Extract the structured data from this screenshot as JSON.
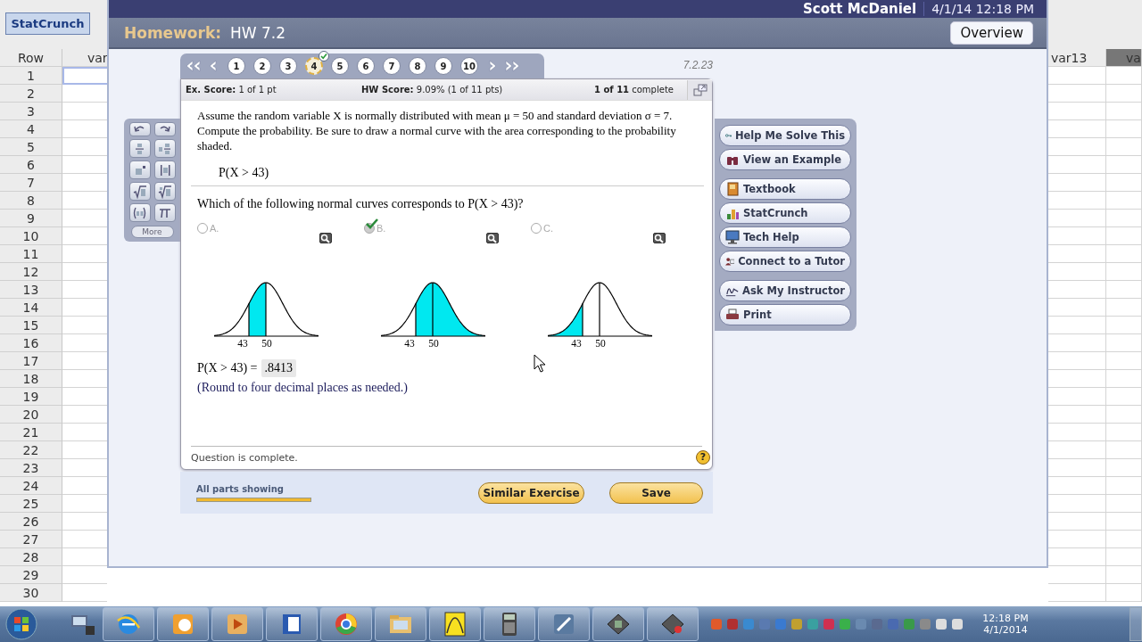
{
  "sheet": {
    "toolbar_button": "StatCrunch",
    "corner": "Row",
    "columns_left": [
      "var"
    ],
    "columns_right": [
      "var13",
      "va"
    ],
    "rows": [
      "1",
      "2",
      "3",
      "4",
      "5",
      "6",
      "7",
      "8",
      "9",
      "10",
      "11",
      "12",
      "13",
      "14",
      "15",
      "16",
      "17",
      "18",
      "19",
      "20",
      "21",
      "22",
      "23",
      "24",
      "25",
      "26",
      "27",
      "28",
      "29",
      "30"
    ]
  },
  "window": {
    "user": "Scott McDaniel",
    "datetime": "4/1/14 12:18 PM",
    "label": "Homework:",
    "title": "HW 7.2",
    "overview_button": "Overview"
  },
  "navigation": {
    "questions": [
      {
        "number": "1",
        "selected": false,
        "completed": false
      },
      {
        "number": "2",
        "selected": false,
        "completed": false
      },
      {
        "number": "3",
        "selected": false,
        "completed": false
      },
      {
        "number": "4",
        "selected": true,
        "completed": true
      },
      {
        "number": "5",
        "selected": false,
        "completed": false
      },
      {
        "number": "6",
        "selected": false,
        "completed": false
      },
      {
        "number": "7",
        "selected": false,
        "completed": false
      },
      {
        "number": "8",
        "selected": false,
        "completed": false
      },
      {
        "number": "9",
        "selected": false,
        "completed": false
      },
      {
        "number": "10",
        "selected": false,
        "completed": false
      }
    ],
    "question_id": "7.2.23"
  },
  "score_bar": {
    "ex_score": "**Ex. Score:** 1 of 1 pt",
    "hw_score": "**HW Score:** 9.09% (1 of 11 pts)",
    "progress": "**1 of 11** complete"
  },
  "question": {
    "text": "Assume the random variable X is normally distributed with mean μ = 50 and standard deviation σ = 7. Compute the probability. Be sure to draw a normal curve with the area corresponding to the probability shaded.",
    "expression": "P(X > 43)",
    "prompt": "Which of the following normal curves corresponds to P(X > 43)?",
    "options": [
      {
        "label": "A.",
        "selected": false,
        "kind": "between",
        "ticks": [
          "43",
          "50"
        ]
      },
      {
        "label": "B.",
        "selected": true,
        "kind": "right",
        "ticks": [
          "43",
          "50"
        ]
      },
      {
        "label": "C.",
        "selected": false,
        "kind": "left",
        "ticks": [
          "43",
          "50"
        ]
      }
    ],
    "answer_label": "P(X > 43) =",
    "answer_value": ".8413",
    "note": "(Round to four decimal places as needed.)",
    "status": "Question is complete.",
    "help_mark": "?"
  },
  "math_palette": {
    "more_button": "More"
  },
  "help_groups": [
    [
      {
        "label": "Help Me Solve This"
      },
      {
        "label": "View an Example"
      }
    ],
    [
      {
        "label": "Textbook"
      },
      {
        "label": "StatCrunch"
      },
      {
        "label": "Tech Help"
      },
      {
        "label": "Connect to a Tutor"
      }
    ],
    [
      {
        "label": "Ask My Instructor"
      },
      {
        "label": "Print"
      }
    ]
  ],
  "footer": {
    "parts_label": "All parts showing",
    "level": 1,
    "buttons": [
      "Similar Exercise",
      "Save"
    ]
  },
  "taskbar": {
    "time": "12:18 PM",
    "date": "4/1/2014"
  }
}
